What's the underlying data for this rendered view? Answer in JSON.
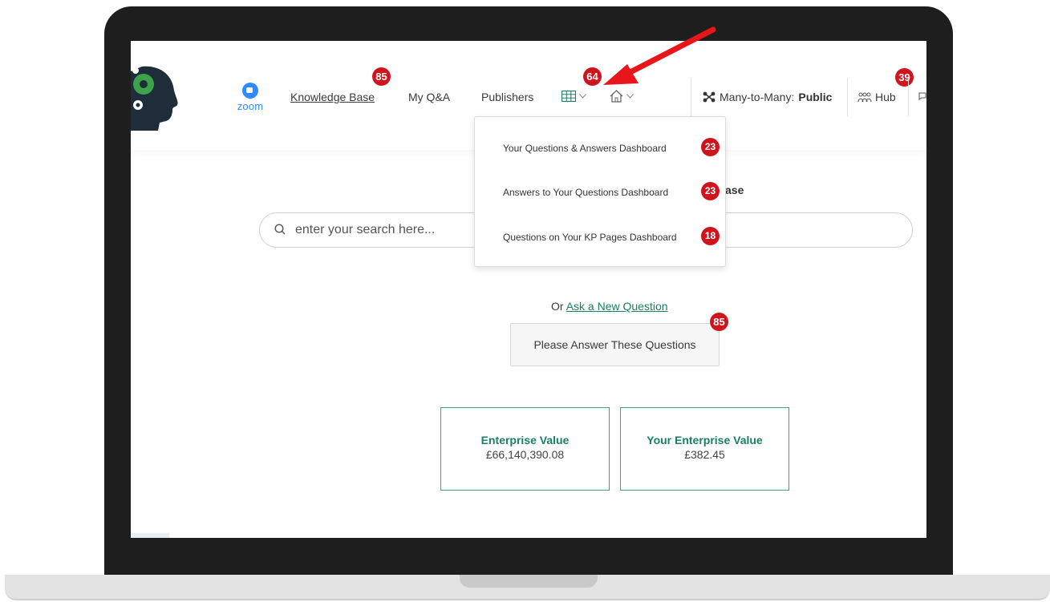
{
  "nav": {
    "zoom_label": "zoom",
    "knowledge_base": "Knowledge Base",
    "knowledge_base_badge": "85",
    "my_qa": "My Q&A",
    "publishers": "Publishers",
    "grid_badge": "64",
    "many_to_many": "Many-to-Many:",
    "many_to_many_value": "Public",
    "hub": "Hub",
    "hub_badge": "39"
  },
  "dropdown": {
    "items": [
      {
        "label": "Your Questions & Answers Dashboard",
        "badge": "23"
      },
      {
        "label": "Answers to Your Questions Dashboard",
        "badge": "23"
      },
      {
        "label": "Questions on Your KP Pages Dashboard",
        "badge": "18"
      }
    ]
  },
  "main": {
    "title_fragment": "ase",
    "search_placeholder": "enter your search here...",
    "ask_prefix": "Or",
    "ask_link": "Ask a New Question",
    "answer_button": "Please Answer These Questions",
    "answer_badge": "85",
    "cards": [
      {
        "title": "Enterprise Value",
        "value": "£66,140,390.08"
      },
      {
        "title": "Your Enterprise Value",
        "value": "£382.45"
      }
    ]
  },
  "colors": {
    "badge": "#d0141d",
    "accent_green": "#1a7f64",
    "zoom_blue": "#2d8cff",
    "arrow": "#e8161a"
  },
  "icons": [
    "zoom-icon",
    "grid-icon",
    "home-icon",
    "many-to-many-icon",
    "hub-icon",
    "search-icon"
  ]
}
